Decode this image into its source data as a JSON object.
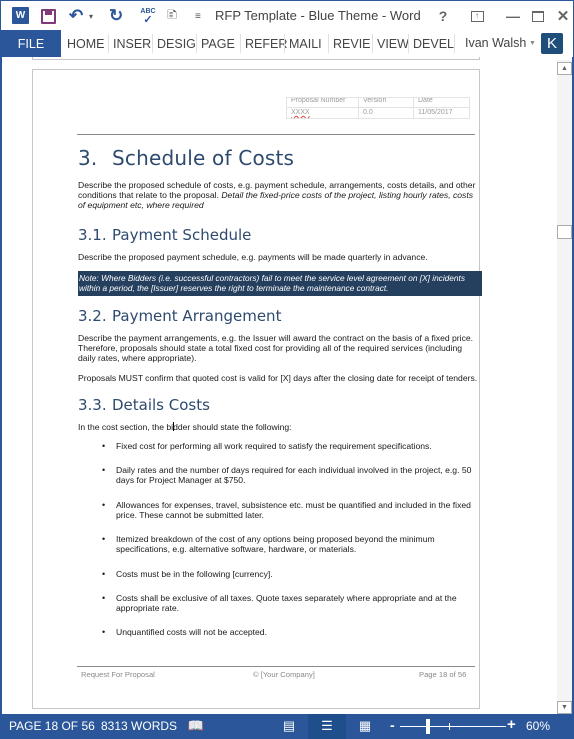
{
  "titlebar": {
    "app_icon": "word-icon",
    "title": "RFP Template - Blue Theme - Word",
    "quick_access": [
      "save-icon",
      "undo-icon",
      "redo-icon",
      "spelling-check-icon",
      "new-comment-icon",
      "customize-qat-icon"
    ],
    "word_icon_letter": "W",
    "spell_label": "ABC",
    "help_label": "?"
  },
  "ribbon": {
    "tabs": [
      {
        "label": "FILE",
        "active": true
      },
      {
        "label": "HOME"
      },
      {
        "label": "INSER"
      },
      {
        "label": "DESIG"
      },
      {
        "label": "PAGE"
      },
      {
        "label": "REFER"
      },
      {
        "label": "MAILI"
      },
      {
        "label": "REVIE"
      },
      {
        "label": "VIEW"
      },
      {
        "label": "DEVEL"
      }
    ],
    "user_name": "Ivan Walsh",
    "user_initial": "K"
  },
  "header_table": {
    "columns": [
      "Proposal Number",
      "Version",
      "Date"
    ],
    "values": [
      "XXXX",
      "0.0",
      "11/05/2017"
    ]
  },
  "document": {
    "section": {
      "number": "3.",
      "title": "Schedule of Costs"
    },
    "intro_text": "Describe the proposed schedule of costs, e.g. payment schedule, arrangements, costs details, and other conditions that relate to the proposal. ",
    "intro_italic": "Detail the fixed-price costs of the project, listing hourly rates, costs of equipment etc, where required",
    "sub1": {
      "number": "3.1.",
      "title": "Payment Schedule"
    },
    "sub1_text": "Describe the proposed payment schedule, e.g. payments will be made quarterly in advance.",
    "note": "Note: Where Bidders (i.e. successful contractors) fail to meet the service level agreement on [X] incidents within a period, the [Issuer] reserves the right to terminate the maintenance contract.",
    "sub2": {
      "number": "3.2.",
      "title": "Payment Arrangement"
    },
    "sub2_text1": "Describe the payment arrangements, e.g. the Issuer will award the contract on the basis of a fixed price. Therefore, proposals should state a total fixed cost for providing all of the required services (including daily rates, where appropriate).",
    "sub2_text2": "Proposals MUST confirm that quoted cost is valid for [X] days after the closing date for receipt of tenders.",
    "sub3": {
      "number": "3.3.",
      "title": "Details Costs"
    },
    "sub3_intro_before_cursor": "In the cost section, the bi",
    "sub3_intro_after_cursor": "dder should state the following:",
    "bullets": [
      "Fixed cost for performing all work required to satisfy the requirement specifications.",
      "Daily rates and the number of days required for each individual involved in the project, e.g. 50 days for Project Manager at $750.",
      "Allowances for expenses, travel, subsistence etc. must be quantified and included in the fixed price. These cannot be submitted later.",
      "Itemized breakdown of the cost of any options being proposed beyond the minimum specifications, e.g. alternative software, hardware, or materials.",
      "Costs must be in the following [currency].",
      "Costs shall be exclusive of all taxes. Quote taxes separately where appropriate and at the appropriate rate.",
      "Unquantified costs will not be accepted."
    ],
    "bullet_glyph": "•"
  },
  "footer": {
    "left": "Request For Proposal",
    "center": "© [Your Company]",
    "right": "Page 18 of 56"
  },
  "statusbar": {
    "page": "PAGE 18 OF 56",
    "words": "8313 WORDS",
    "zoom_level": "60%",
    "zoom_percent": 60,
    "view_modes": [
      "read-mode-icon",
      "print-layout-icon",
      "web-layout-icon"
    ],
    "active_view": "print-layout"
  },
  "scrollbar": {
    "position_fraction": 0.26
  },
  "colors": {
    "accent": "#2b579a",
    "heading": "#2e4a6e",
    "note_bg": "#253f5e",
    "avatar_bg": "#1e4e79"
  }
}
